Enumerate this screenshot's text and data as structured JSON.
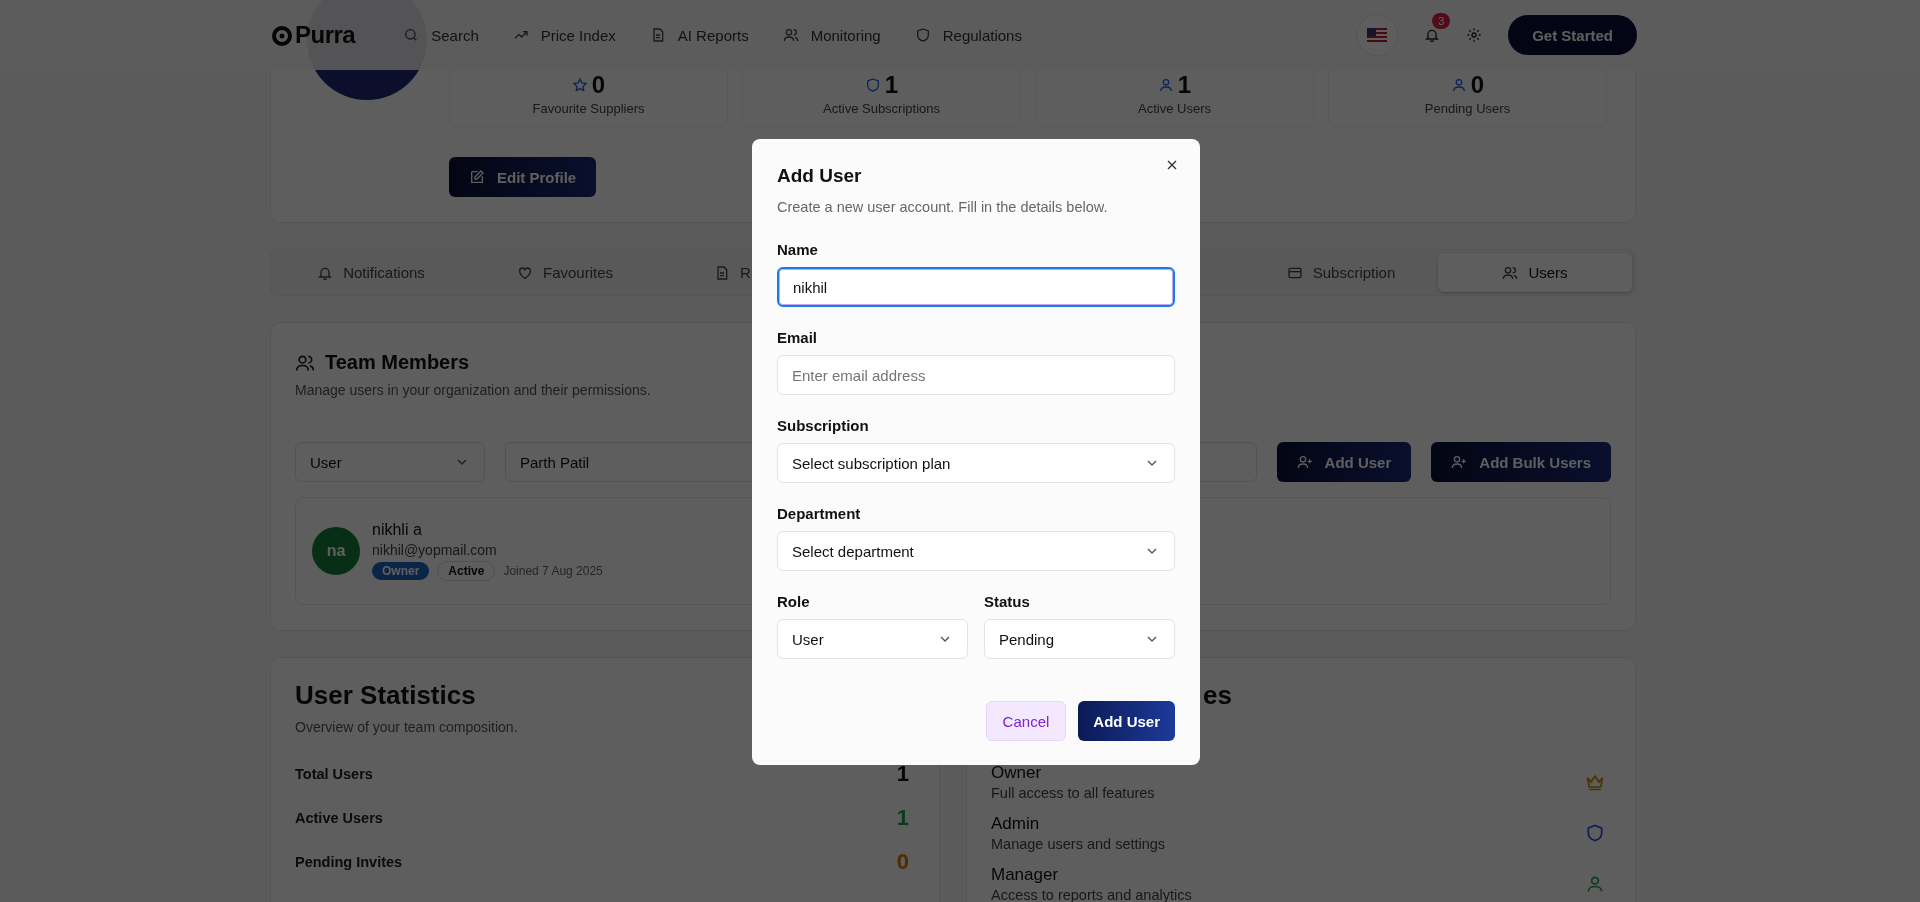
{
  "header": {
    "logo": "Purra",
    "nav": [
      {
        "label": "Search"
      },
      {
        "label": "Price Index"
      },
      {
        "label": "AI Reports"
      },
      {
        "label": "Monitoring"
      },
      {
        "label": "Regulations"
      }
    ],
    "notification_count": "3",
    "cta": "Get Started"
  },
  "profile": {
    "stats": [
      {
        "value": "0",
        "label": "Favourite Suppliers"
      },
      {
        "value": "1",
        "label": "Active Subscriptions"
      },
      {
        "value": "1",
        "label": "Active Users"
      },
      {
        "value": "0",
        "label": "Pending Users"
      }
    ],
    "edit_button": "Edit Profile"
  },
  "tabs": [
    {
      "label": "Notifications",
      "selected": false
    },
    {
      "label": "Favourites",
      "selected": false
    },
    {
      "label": "R",
      "selected": false
    },
    {
      "label": "Subscription",
      "selected": false
    },
    {
      "label": "Users",
      "selected": true
    }
  ],
  "team": {
    "title": "Team Members",
    "subtitle": "Manage users in your organization and their permissions.",
    "role_filter": "User",
    "search_value": "Parth Patil",
    "add_user": "Add User",
    "add_bulk": "Add Bulk Users",
    "members": [
      {
        "initials": "na",
        "name": "nikhli a",
        "email": "nikhil@yopmail.com",
        "role": "Owner",
        "status": "Active",
        "joined": "Joined 7 Aug 2025"
      }
    ]
  },
  "user_statistics": {
    "title": "User Statistics",
    "subtitle": "Overview of your team composition.",
    "rows": [
      {
        "label": "Total Users",
        "value": "1"
      },
      {
        "label": "Active Users",
        "value": "1"
      },
      {
        "label": "Pending Invites",
        "value": "0"
      }
    ]
  },
  "roles": {
    "title_fragment": "es",
    "items": [
      {
        "name": "Owner",
        "description": "Full access to all features"
      },
      {
        "name": "Admin",
        "description": "Manage users and settings"
      },
      {
        "name": "Manager",
        "description": "Access to reports and analytics"
      }
    ]
  },
  "dialog": {
    "title": "Add User",
    "description": "Create a new user account. Fill in the details below.",
    "name": {
      "label": "Name",
      "value": "nikhil",
      "focused": true
    },
    "email": {
      "label": "Email",
      "placeholder": "Enter email address"
    },
    "subscription": {
      "label": "Subscription",
      "value": "Select subscription plan"
    },
    "department": {
      "label": "Department",
      "value": "Select department"
    },
    "role": {
      "label": "Role",
      "value": "User"
    },
    "status": {
      "label": "Status",
      "value": "Pending"
    },
    "cancel": "Cancel",
    "submit": "Add User"
  }
}
